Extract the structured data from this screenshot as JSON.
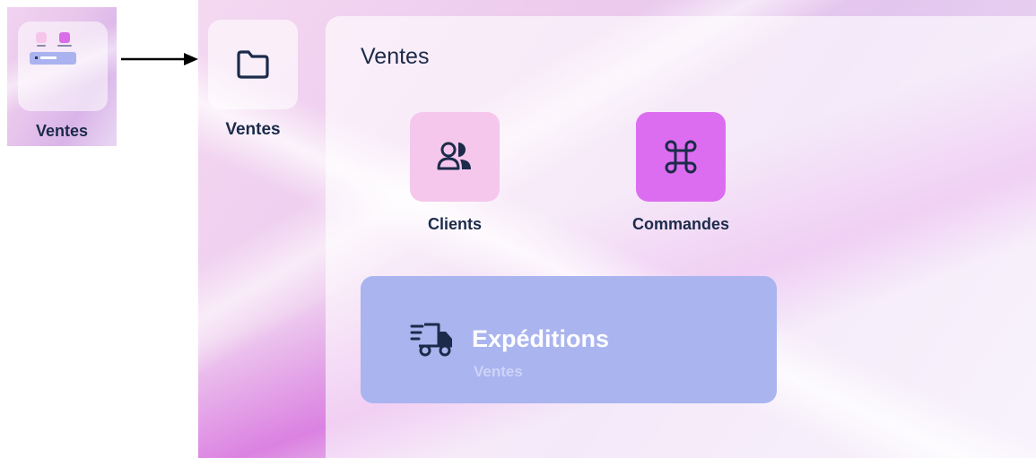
{
  "thumbnail": {
    "label": "Ventes"
  },
  "expanded": {
    "folder_label": "Ventes",
    "window": {
      "title": "Ventes",
      "apps": [
        {
          "label": "Clients",
          "icon": "users-icon",
          "color": "#f5c7ec"
        },
        {
          "label": "Commandes",
          "icon": "command-icon",
          "color": "#dc6df0"
        }
      ],
      "widget": {
        "title": "Expéditions",
        "subtitle": "Ventes",
        "icon": "delivery-truck-icon",
        "color": "#aab4ef"
      }
    }
  }
}
